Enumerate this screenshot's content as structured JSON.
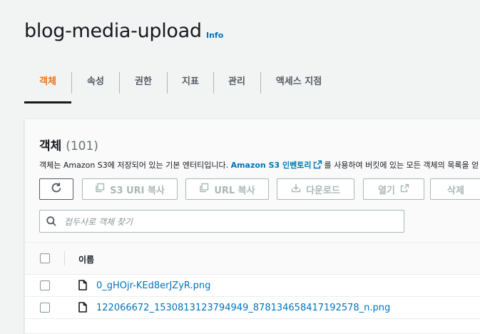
{
  "header": {
    "title": "blog-media-upload",
    "info_label": "Info"
  },
  "tabs": [
    {
      "label": "객체",
      "active": true
    },
    {
      "label": "속성"
    },
    {
      "label": "권한"
    },
    {
      "label": "지표"
    },
    {
      "label": "관리"
    },
    {
      "label": "액세스 지점"
    }
  ],
  "objects_panel": {
    "title": "객체",
    "count": "(101)",
    "description_prefix": "객체는 Amazon S3에 저장되어 있는 기본 엔터티입니다.",
    "inventory_link": "Amazon S3 인벤토리",
    "description_suffix": "를 사용하여 버킷에 있는 모든 객체의 목록을 얻",
    "actions": {
      "refresh": "refresh-icon",
      "copy_s3_uri": "S3 URI 복사",
      "copy_url": "URL 복사",
      "download": "다운로드",
      "open": "열기",
      "delete": "삭제"
    },
    "search": {
      "placeholder": "접두사로 객체 찾기",
      "value": ""
    },
    "table": {
      "columns": [
        "이름"
      ],
      "rows": [
        {
          "name": "0_gHOjr-KEd8erJZyR.png"
        },
        {
          "name": "122066672_1530813123794949_878134658417192578_n.png"
        }
      ]
    }
  },
  "colors": {
    "accent": "#ec7211",
    "link": "#0073bb",
    "text": "#16191f",
    "muted": "#545b64"
  }
}
